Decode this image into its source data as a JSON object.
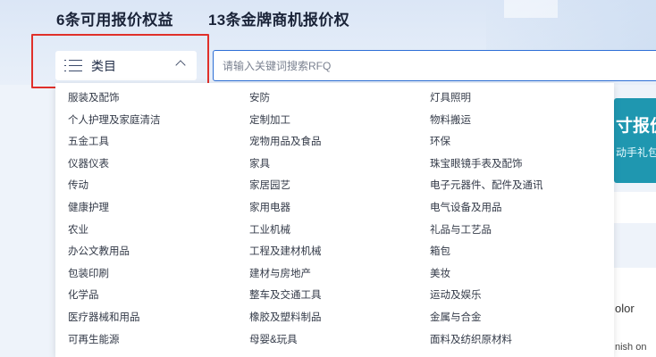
{
  "header": {
    "headline_1": "6条可用报价权益",
    "headline_2": "13条金牌商机报价权"
  },
  "category_button": {
    "label": "类目",
    "icon": "list-icon"
  },
  "search": {
    "placeholder": "请输入关键词搜索RFQ",
    "value": ""
  },
  "categories": {
    "column_1": [
      "服装及配饰",
      "个人护理及家庭清洁",
      "五金工具",
      "仪器仪表",
      "传动",
      "健康护理",
      "农业",
      "办公文教用品",
      "包装印刷",
      "化学品",
      "医疗器械和用品",
      "可再生能源"
    ],
    "column_2": [
      "安防",
      "定制加工",
      "宠物用品及食品",
      "家具",
      "家居园艺",
      "家用电器",
      "工业机械",
      "工程及建材机械",
      "建材与房地产",
      "整车及交通工具",
      "橡胶及塑料制品",
      "母婴&玩具"
    ],
    "column_3": [
      "灯具照明",
      "物料搬运",
      "环保",
      "珠宝眼镜手表及配饰",
      "电子元器件、配件及通讯",
      "电气设备及用品",
      "礼品与工艺品",
      "箱包",
      "美妆",
      "运动及娱乐",
      "金属与合金",
      "面料及纺织原材料"
    ]
  },
  "background": {
    "promo_title": "寸报价",
    "promo_sub": "动手礼包",
    "peek_1": "olor",
    "peek_2": "nish on"
  },
  "colors": {
    "highlight": "#e0302a",
    "input_border": "#2d6fd6",
    "promo": "#1f97b0"
  }
}
